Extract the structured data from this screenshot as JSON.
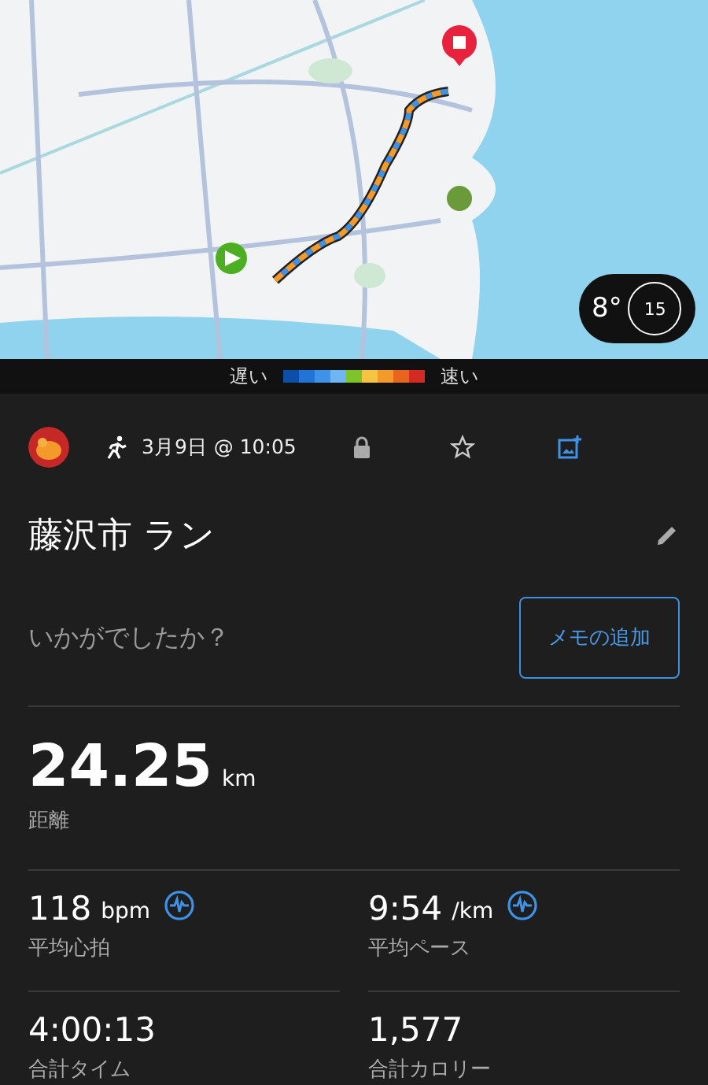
{
  "map": {
    "kind": "picture",
    "weather": {
      "temperature": "8°",
      "wind": "15"
    }
  },
  "legend": {
    "slow": "遅い",
    "fast": "速い",
    "colors": [
      {
        "color": "#0d4fa8"
      },
      {
        "color": "#1f74d6"
      },
      {
        "color": "#3d93ea"
      },
      {
        "color": "#6fb5f2"
      },
      {
        "color": "#7cc42a"
      },
      {
        "color": "#f5c542"
      },
      {
        "color": "#f39a2b"
      },
      {
        "color": "#e8661c"
      },
      {
        "color": "#d42a22"
      }
    ]
  },
  "activity": {
    "date": "3月9日 @ 10:05",
    "title": "藤沢市 ラン",
    "memo_placeholder": "いかがでしたか？",
    "memo_button": "メモの追加"
  },
  "distance": {
    "value": "24.25",
    "unit": "km",
    "label": "距離"
  },
  "stats": [
    {
      "value": "118",
      "unit": "bpm",
      "label": "平均心拍",
      "chart_link": true
    },
    {
      "value": "9:54",
      "unit": "/km",
      "label": "平均ペース",
      "chart_link": true
    },
    {
      "value": "4:00:13",
      "label": "合計タイム",
      "chart_link": false
    },
    {
      "value": "1,577",
      "label": "合計カロリー",
      "chart_link": false
    }
  ]
}
